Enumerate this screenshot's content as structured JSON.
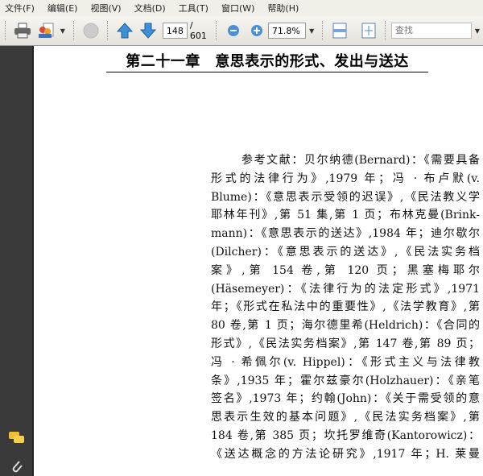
{
  "menu": [
    "文件(F)",
    "编辑(E)",
    "视图(V)",
    "文档(D)",
    "工具(T)",
    "窗口(W)",
    "帮助(H)"
  ],
  "toolbar": {
    "page_current": "148",
    "page_total": "/ 601",
    "zoom": "71.8%",
    "search_placeholder": "查找"
  },
  "document": {
    "title": "第二十一章　意思表示的形式、发出与送达",
    "lines": [
      "参考文献：贝尔纳德(Bernard)：《需要具备",
      "形式的法律行为》,1979 年；冯 · 布卢默(v.",
      "Blume)：《意思表示受领的迟误》,《民法教义学",
      "耶林年刊》,第 51 集,第 1 页；布林克曼(Brink-",
      "mann)：《意思表示的送达》,1984 年；迪尔歇尔",
      "(Dilcher)：《意思表示的送达》,《民法实务档",
      "案》,第 154 卷,第 120 页；黑塞梅耶尔",
      "(Häsemeyer)：《法律行为的法定形式》,1971",
      "年；《形式在私法中的重要性》,《法学教育》,第",
      "80 卷,第 1 页；海尔德里希(Heldrich)：《合同的",
      "形式》,《民法实务档案》,第 147 卷,第 89 页；",
      "冯 · 希佩尔(v. Hippel)：《形式主义与法律教",
      "条》,1935 年；霍尔兹豪尔(Holzhauer)：《亲笔",
      "签名》,1973 年；约翰(John)：《关于需受领的意",
      "思表示生效的基本问题》,《民法实务档案》,第",
      "184 卷,第 385 页；坎托罗维奇(Kantorowicz)：",
      "《送达概念的方法论研究》,1917 年；H. 莱曼"
    ]
  }
}
